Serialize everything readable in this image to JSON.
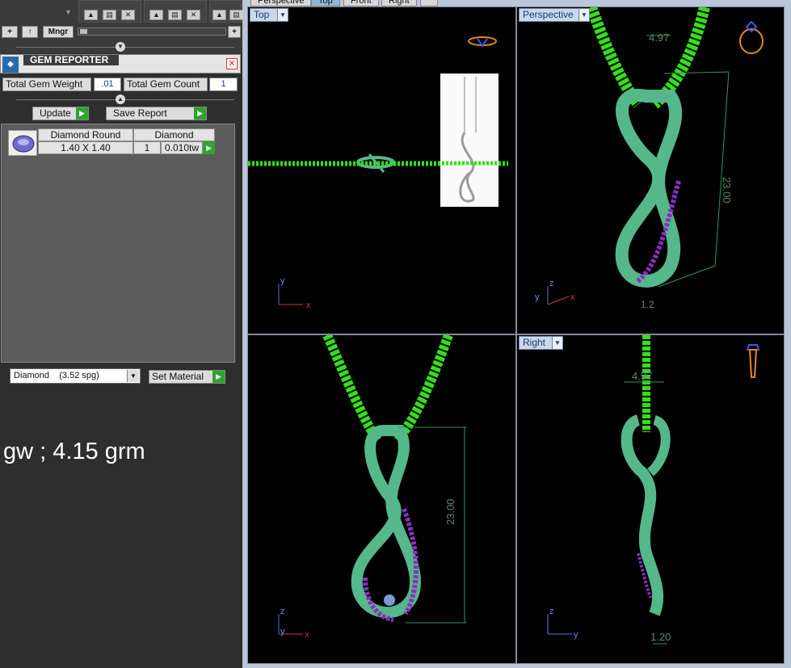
{
  "toolbar": {
    "plus_label": "+",
    "up_label": "↑",
    "mngr_label": "Mngr",
    "end_plus_label": "+"
  },
  "gem_reporter": {
    "title": "GEM REPORTER",
    "total_gem_weight_label": "Total Gem Weight",
    "total_gem_weight_value": ".01",
    "total_gem_count_label": "Total Gem Count",
    "total_gem_count_value": "1",
    "update_label": "Update",
    "save_report_label": "Save Report",
    "gem_row": {
      "shape": "Diamond Round",
      "size": "1.40 X 1.40",
      "material": "Diamond",
      "count": "1",
      "weight": "0.010tw"
    },
    "material_select": "Diamond    (3.52 spg)",
    "set_material_label": "Set Material"
  },
  "note_text": "gw ; 4.15 grm",
  "viewport_tabs": [
    "Perspective",
    "Top",
    "Front",
    "Right"
  ],
  "viewports": {
    "top": {
      "label": "Top"
    },
    "perspective": {
      "label": "Perspective",
      "dim_width": "4.97",
      "dim_height": "23.00",
      "dim_depth": "1.2"
    },
    "front": {
      "dim_height": "23.00"
    },
    "right": {
      "label": "Right",
      "dim_width": "4.97",
      "dim_depth": "1.20"
    }
  },
  "axes": {
    "x": "x",
    "y": "y",
    "z": "z"
  },
  "colors": {
    "chain": "#33e01a",
    "pendant": "#55b88a",
    "gems": "#8a2fc0",
    "dim": "#2a9a5a",
    "axis_red": "#d23b2b",
    "axis_blue": "#5577cc"
  }
}
